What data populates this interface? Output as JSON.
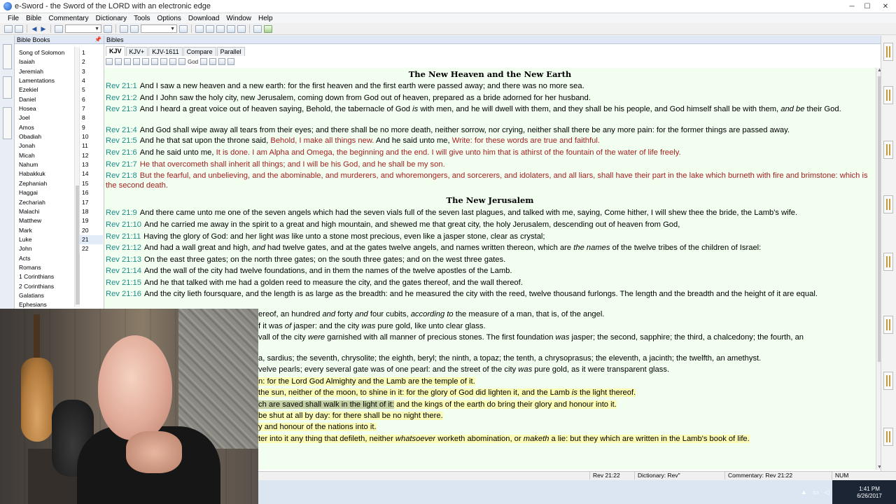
{
  "window": {
    "title": "e-Sword - the Sword of the LORD with an electronic edge",
    "minimize": "─",
    "maximize": "☐",
    "close": "✕"
  },
  "menu": [
    "File",
    "Bible",
    "Commentary",
    "Dictionary",
    "Tools",
    "Options",
    "Download",
    "Window",
    "Help"
  ],
  "left_panel": {
    "header": "Bible Books",
    "books": [
      "Song of Solomon",
      "Isaiah",
      "Jeremiah",
      "Lamentations",
      "Ezekiel",
      "Daniel",
      "Hosea",
      "Joel",
      "Amos",
      "Obadiah",
      "Jonah",
      "Micah",
      "Nahum",
      "Habakkuk",
      "Zephaniah",
      "Haggai",
      "Zechariah",
      "Malachi",
      "Matthew",
      "Mark",
      "Luke",
      "John",
      "Acts",
      "Romans",
      "1 Corinthians",
      "2 Corinthians",
      "Galatians",
      "Ephesians"
    ],
    "chapters": [
      "1",
      "2",
      "3",
      "4",
      "5",
      "6",
      "7",
      "8",
      "9",
      "10",
      "11",
      "12",
      "13",
      "14",
      "15",
      "16",
      "17",
      "18",
      "19",
      "20",
      "21",
      "22"
    ],
    "selected_chapter": "21"
  },
  "bible_panel": {
    "header": "Bibles",
    "tabs": [
      "KJV",
      "KJV+",
      "KJV-1611",
      "Compare",
      "Parallel"
    ],
    "active_tab": "KJV",
    "toolbar_label": "God",
    "headings": {
      "h1": "The New Heaven and the New Earth",
      "h2": "The New Jerusalem"
    },
    "verses": {
      "v1": {
        "ref": "Rev 21:1",
        "a": "And I saw a new heaven and a new earth: for the first heaven and the first earth were passed away; and there was no more sea."
      },
      "v2": {
        "ref": "Rev 21:2",
        "a": "And I John saw the holy city, new Jerusalem, coming down from God out of heaven, prepared as a bride adorned for her husband."
      },
      "v3": {
        "ref": "Rev 21:3",
        "a": "And I heard a great voice out of heaven saying, Behold, the tabernacle of God ",
        "i1": "is",
        "b": " with men, and he will dwell with them, and they shall be his people, and God himself shall be with them, ",
        "i2": "and be",
        "c": " their God."
      },
      "v4": {
        "ref": "Rev 21:4",
        "a": "And God shall wipe away all tears from their eyes; and there shall be no more death, neither sorrow, nor crying, neither shall there be any more pain: for the former things are passed away."
      },
      "v5": {
        "ref": "Rev 21:5",
        "a": "And he that sat upon the throne said, ",
        "r1": "Behold, I make all things new.",
        "b": " And he said unto me, ",
        "r2": "Write: for these words are true and faithful."
      },
      "v6": {
        "ref": "Rev 21:6",
        "a": "And he said unto me, ",
        "r1": "It is done. I am Alpha and Omega, the beginning and the end. I will give unto him that is athirst of the fountain of the water of life freely."
      },
      "v7": {
        "ref": "Rev 21:7",
        "r1": "He that overcometh shall inherit all things; and I will be his God, and he shall be my son."
      },
      "v8": {
        "ref": "Rev 21:8",
        "r1": "But the fearful, and unbelieving, and the abominable, and murderers, and whoremongers, and sorcerers, and idolaters, and all liars, shall have their part in the lake which burneth with fire and brimstone: which is the second death."
      },
      "v9": {
        "ref": "Rev 21:9",
        "a": "And there came unto me one of the seven angels which had the seven vials full of the seven last plagues, and talked with me, saying, Come hither, I will shew thee the bride, the Lamb's wife."
      },
      "v10": {
        "ref": "Rev 21:10",
        "a": "And he carried me away in the spirit to a great and high mountain, and shewed me that great city, the holy Jerusalem, descending out of heaven from God,"
      },
      "v11": {
        "ref": "Rev 21:11",
        "a": "Having the glory of God: and her light ",
        "i1": "was",
        "b": " like unto a stone most precious, even like a jasper stone, clear as crystal;"
      },
      "v12": {
        "ref": "Rev 21:12",
        "a": "And had a wall great and high, ",
        "i1": "and",
        "b": " had twelve gates, and at the gates twelve angels, and names written thereon, which are ",
        "i2": "the names",
        "c": " of the twelve tribes of the children of Israel:"
      },
      "v13": {
        "ref": "Rev 21:13",
        "a": "On the east three gates; on the north three gates; on the south three gates; and on the west three gates."
      },
      "v14": {
        "ref": "Rev 21:14",
        "a": "And the wall of the city had twelve foundations, and in them the names of the twelve apostles of the Lamb."
      },
      "v15": {
        "ref": "Rev 21:15",
        "a": "And he that talked with me had a golden reed to measure the city, and the gates thereof, and the wall thereof."
      },
      "v16": {
        "ref": "Rev 21:16",
        "a": "And the city lieth foursquare, and the length is as large as the breadth: and he measured the city with the reed, twelve thousand furlongs. The length and the breadth and the height of it are equal."
      },
      "v17": {
        "a": "ereof, an hundred ",
        "i1": "and",
        "b": " forty ",
        "i2": "and",
        "c": " four cubits, ",
        "i3": "according to",
        "d": " the measure of a man, that is, of the angel."
      },
      "v18": {
        "a": "f it was ",
        "i1": "of",
        "b": " jasper: and the city ",
        "i2": "was",
        "c": " pure gold, like unto clear glass."
      },
      "v19": {
        "a": "vall of the city ",
        "i1": "were",
        "b": " garnished with all manner of precious stones. The first foundation ",
        "i2": "was",
        "c": " jasper; the second, sapphire; the third, a chalcedony; the fourth, an"
      },
      "v20": {
        "a": "a, sardius; the seventh, chrysolite; the eighth, beryl; the ninth, a topaz; the tenth, a chrysoprasus; the eleventh, a jacinth; the twelfth, an amethyst."
      },
      "v21": {
        "a": "velve pearls; every several gate was of one pearl: and the street of the city ",
        "i1": "was",
        "b": " pure gold, as it were transparent glass."
      },
      "v22": {
        "a": "n: for the Lord God Almighty and the Lamb are the temple of it."
      },
      "v23": {
        "a": "the sun, neither of the moon, to shine in it: for the glory of God did lighten it, and the Lamb ",
        "i1": "is",
        "b": " the light thereof."
      },
      "v24": {
        "a": "ch are saved shall walk in the light of it:",
        "b": " and the kings of the earth do bring their glory and honour into it."
      },
      "v25": {
        "a": "be shut at all by day: for there shall be no night there."
      },
      "v26": {
        "a": "y and honour of the nations into it."
      },
      "v27": {
        "a": "ter into it any thing that defileth, neither ",
        "i1": "whatsoever",
        "b": " worketh abomination, or ",
        "i2": "maketh",
        "c": " a lie: but they which are written in the Lamb's book of life."
      }
    }
  },
  "status": {
    "ref": "Rev 21:22",
    "dictionary": "Dictionary: Rev\"",
    "commentary": "Commentary: Rev 21:22",
    "num": "NUM"
  },
  "taskbar": {
    "time": "1:41 PM",
    "date": "6/26/2017"
  }
}
